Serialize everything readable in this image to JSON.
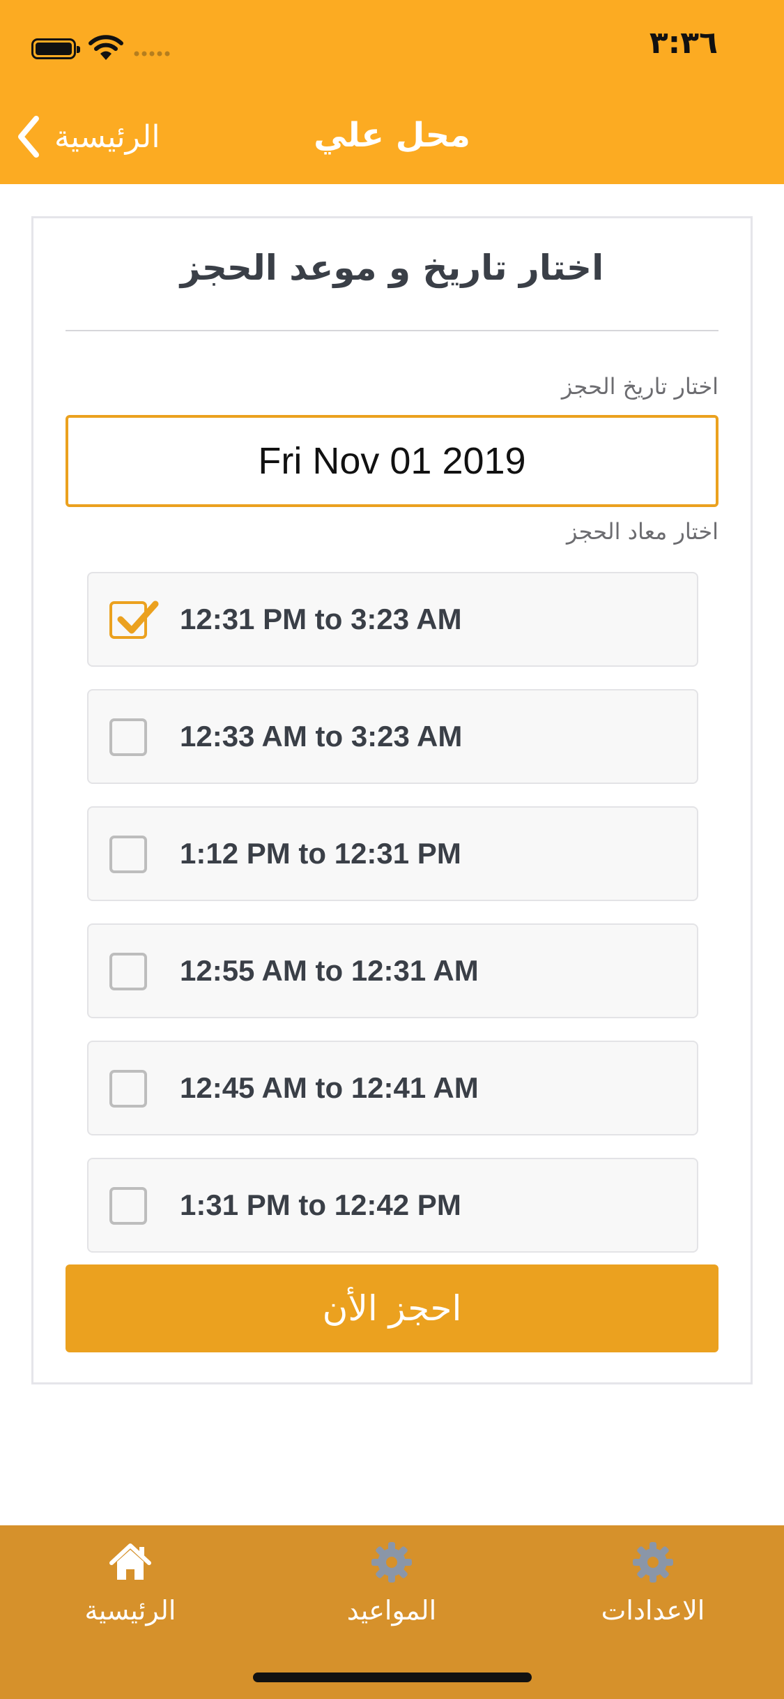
{
  "status_bar": {
    "time": "٣:٣٦",
    "icons": [
      "battery-icon",
      "wifi-icon",
      "signal-icon"
    ]
  },
  "nav": {
    "title": "محل علي",
    "back_label": "الرئيسية",
    "back_icon": "chevron-left-icon"
  },
  "card": {
    "title": "اختار تاريخ و موعد الحجز",
    "date_label": "اختار تاريخ الحجز",
    "date_value": "Fri Nov 01 2019",
    "time_label": "اختار معاد الحجز",
    "slots": [
      {
        "label": "12:31 PM to 3:23 AM",
        "checked": true
      },
      {
        "label": "12:33 AM to 3:23 AM",
        "checked": false
      },
      {
        "label": "1:12 PM to 12:31 PM",
        "checked": false
      },
      {
        "label": "12:55 AM to 12:31 AM",
        "checked": false
      },
      {
        "label": "12:45 AM to 12:41 AM",
        "checked": false
      },
      {
        "label": "1:31 PM to 12:42 PM",
        "checked": false
      }
    ],
    "book_button": "احجز الأن"
  },
  "tabs": [
    {
      "label": "الرئيسية",
      "icon": "home-icon"
    },
    {
      "label": "المواعيد",
      "icon": "gear-icon"
    },
    {
      "label": "الاعدادات",
      "icon": "gear-icon"
    }
  ],
  "colors": {
    "header": "#fcab22",
    "accent": "#eba11f",
    "tab_bar": "#d6912b",
    "tab_icon_inactive": "#8a96a8"
  }
}
